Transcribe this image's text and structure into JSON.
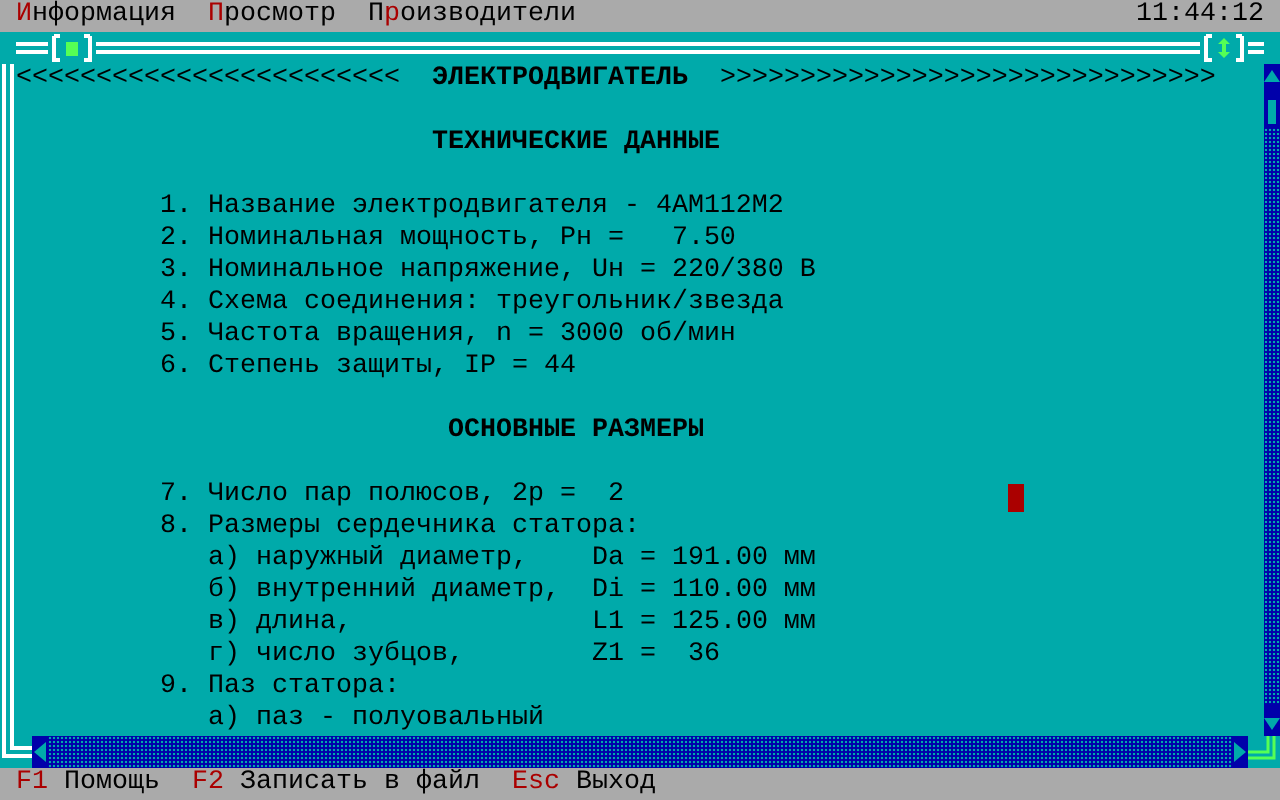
{
  "menu": [
    {
      "hotkey": "И",
      "after": "нформация"
    },
    {
      "hotkey": "П",
      "after": "росмотр"
    },
    {
      "before": "П",
      "hotkey": "р",
      "after": "оизводители"
    }
  ],
  "clock": "11:44:12",
  "window": {
    "header": {
      "left": "<<<<<<<<<<<<<<<<<<<<<<<<",
      "title": "ЭЛЕКТРОДВИГАТЕЛЬ",
      "right": ">>>>>>>>>>>>>>>>>>>>>>>>>>>>>>>"
    },
    "sections": [
      {
        "heading": "ТЕХНИЧЕСКИЕ ДАННЫЕ",
        "items": [
          {
            "text": "1. Название электродвигателя - 4АМ112М2"
          },
          {
            "text": "2. Номинальная мощность, Pн =   7.50"
          },
          {
            "text": "3. Номинальное напряжение, Uн = 220/380 В"
          },
          {
            "text": "4. Схема соединения: треугольник/звезда"
          },
          {
            "text": "5. Частота вращения, n = 3000 об/мин"
          },
          {
            "text": "6. Степень защиты, IP = 44"
          }
        ]
      },
      {
        "heading": "ОСНОВНЫЕ РАЗМЕРЫ",
        "items": [
          {
            "text": "7. Число пар полюсов, 2p =  2"
          },
          {
            "text": "8. Размеры сердечника статора:",
            "children": [
              {
                "text": "а) наружный диаметр,    Da = 191.00 мм"
              },
              {
                "text": "б) внутренний диаметр,  Di = 110.00 мм"
              },
              {
                "text": "в) длина,               L1 = 125.00 мм"
              },
              {
                "text": "г) число зубцов,        Z1 =  36"
              }
            ]
          },
          {
            "text": "9. Паз статора:",
            "children": [
              {
                "text": "а) паз - полуовальный"
              }
            ]
          }
        ]
      }
    ]
  },
  "status_bar": [
    {
      "key": "F1",
      "label": "Помощь"
    },
    {
      "key": "F2",
      "label": "Записать в файл"
    },
    {
      "key": "Esc",
      "label": "Выход"
    }
  ]
}
